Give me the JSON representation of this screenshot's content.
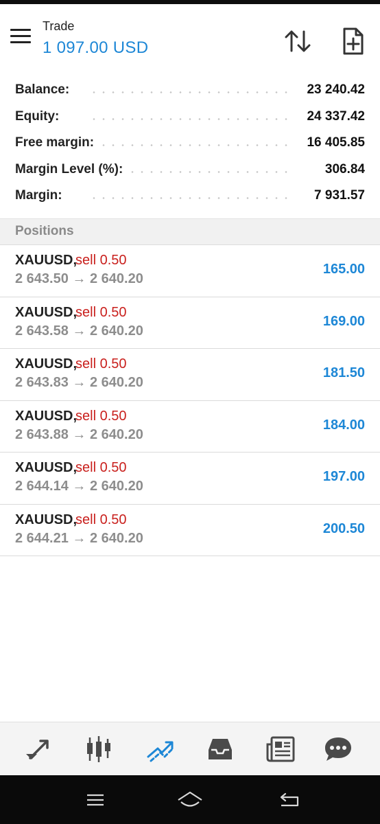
{
  "header": {
    "title": "Trade",
    "subtitle": "1 097.00 USD",
    "icons": [
      "menu-icon",
      "sort-icon",
      "new-order-icon"
    ]
  },
  "summary": [
    {
      "label": "Balance:",
      "value": "23 240.42"
    },
    {
      "label": "Equity:",
      "value": "24 337.42"
    },
    {
      "label": "Free margin:",
      "value": "16 405.85"
    },
    {
      "label": "Margin Level (%):",
      "value": "306.84"
    },
    {
      "label": "Margin:",
      "value": "7 931.57"
    }
  ],
  "positions": {
    "header": "Positions",
    "rows": [
      {
        "symbol": "XAUUSD,",
        "side": "sell 0.50",
        "prices": "2 643.50 → 2 640.20",
        "profit": "165.00"
      },
      {
        "symbol": "XAUUSD,",
        "side": "sell 0.50",
        "prices": "2 643.58 → 2 640.20",
        "profit": "169.00"
      },
      {
        "symbol": "XAUUSD,",
        "side": "sell 0.50",
        "prices": "2 643.83 → 2 640.20",
        "profit": "181.50"
      },
      {
        "symbol": "XAUUSD,",
        "side": "sell 0.50",
        "prices": "2 643.88 → 2 640.20",
        "profit": "184.00"
      },
      {
        "symbol": "XAUUSD,",
        "side": "sell 0.50",
        "prices": "2 644.14 → 2 640.20",
        "profit": "197.00"
      },
      {
        "symbol": "XAUUSD,",
        "side": "sell 0.50",
        "prices": "2 644.21 → 2 640.20",
        "profit": "200.50"
      }
    ]
  },
  "bottom_nav": {
    "items": [
      "quotes-icon",
      "chart-icon",
      "trade-icon",
      "history-icon",
      "news-icon",
      "messages-icon"
    ],
    "active": "trade-icon"
  },
  "system_nav": [
    "recent-apps-icon",
    "home-icon",
    "back-icon"
  ],
  "colors": {
    "accent": "#1d87d6",
    "sell": "#c9201d",
    "muted": "#8d8d8d",
    "nav_icon": "#4a4a4a"
  }
}
